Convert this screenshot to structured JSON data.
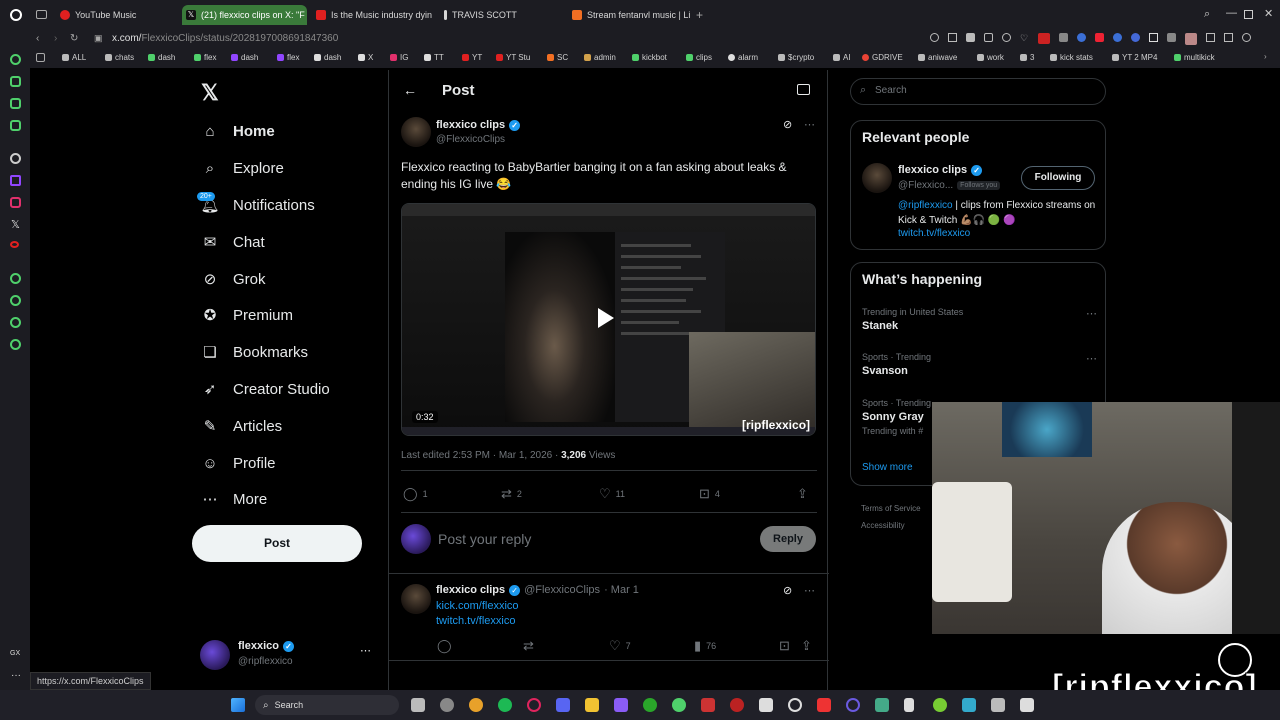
{
  "browser": {
    "tabs": [
      {
        "label": "YouTube Music",
        "color": "#e02020"
      },
      {
        "label": "(21) flexxico clips on X: \"F",
        "color": "#1a1a1a"
      },
      {
        "label": "Is the Music industry dying",
        "color": "#e02020"
      },
      {
        "label": "TRAVIS SCOTT",
        "color": "#d6d6d6"
      },
      {
        "label": "Stream fentanvl music | Lis",
        "color": "#f26f23"
      }
    ],
    "url_host": "x.com/",
    "url_path": "FlexxicoClips/status/2028197008691847360",
    "bookmarks": [
      "ALL",
      "chats",
      "dash",
      "flex",
      "dash",
      "flex",
      "dash",
      "X",
      "IG",
      "TT",
      "YT",
      "YT Stu",
      "SC",
      "admin",
      "kickbot",
      "clips",
      "alarm",
      "$crypto",
      "AI",
      "GDRIVE",
      "aniwave",
      "work",
      "3",
      "kick stats",
      "YT 2 MP4",
      "multikick"
    ],
    "status_url": "https://x.com/FlexxicoClips"
  },
  "nav": {
    "items": [
      {
        "label": "Home",
        "icon": "home-icon"
      },
      {
        "label": "Explore",
        "icon": "search-icon"
      },
      {
        "label": "Notifications",
        "icon": "bell-icon",
        "badge": "20+"
      },
      {
        "label": "Chat",
        "icon": "mail-icon"
      },
      {
        "label": "Grok",
        "icon": "grok-icon"
      },
      {
        "label": "Premium",
        "icon": "premium-icon"
      },
      {
        "label": "Bookmarks",
        "icon": "bookmark-icon"
      },
      {
        "label": "Creator Studio",
        "icon": "rocket-icon"
      },
      {
        "label": "Articles",
        "icon": "article-icon"
      },
      {
        "label": "Profile",
        "icon": "person-icon"
      },
      {
        "label": "More",
        "icon": "more-icon"
      }
    ],
    "post_button": "Post",
    "account_name": "flexxico",
    "account_handle": "@ripflexxico"
  },
  "post": {
    "header": "Post",
    "author_name": "flexxico clips",
    "author_handle": "@FlexxicoClips",
    "text": "Flexxico reacting to BabyBartier banging it on a fan asking about leaks & ending his IG live 😂",
    "video_duration": "0:32",
    "video_watermark": "[ripflexxico]",
    "meta_edited": "Last edited 2:53 PM · Mar 1, 2026 · ",
    "views_count": "3,206",
    "views_label": "Views",
    "replies": "1",
    "reposts": "2",
    "likes": "11",
    "bookmarks": "4",
    "reply_placeholder": "Post your reply",
    "reply_button": "Reply"
  },
  "reply": {
    "author_name": "flexxico clips",
    "author_handle": "@FlexxicoClips",
    "date": "· Mar 1",
    "link1": "kick.com/flexxico",
    "link2": "twitch.tv/flexxico",
    "likes": "7",
    "views": "76"
  },
  "right": {
    "search_placeholder": "Search",
    "relevant_title": "Relevant people",
    "person_name": "flexxico clips",
    "person_handle": "@Flexxico...",
    "follows_you": "Follows you",
    "following_button": "Following",
    "bio_link": "@ripflexxico",
    "bio_text": " | clips from Flexxico streams on Kick & Twitch 💪🏽🎧 🟢 🟣",
    "bio_url": "twitch.tv/flexxico",
    "happening_title": "What’s happening",
    "trends": [
      {
        "context": "Trending in United States",
        "name": "Stanek"
      },
      {
        "context": "Sports · Trending",
        "name": "Svanson"
      },
      {
        "context": "Sports · Trending",
        "name": "Sonny Gray",
        "extra": "Trending with #"
      }
    ],
    "show_more": "Show more",
    "footer1": "Terms of Service",
    "footer2": "Accessibility"
  },
  "overlay": {
    "watermark": "[ripflexxico]"
  },
  "taskbar": {
    "search_label": "Search"
  },
  "colors": {
    "accent": "#1d9bf0",
    "browser_green": "#4fd06b"
  }
}
